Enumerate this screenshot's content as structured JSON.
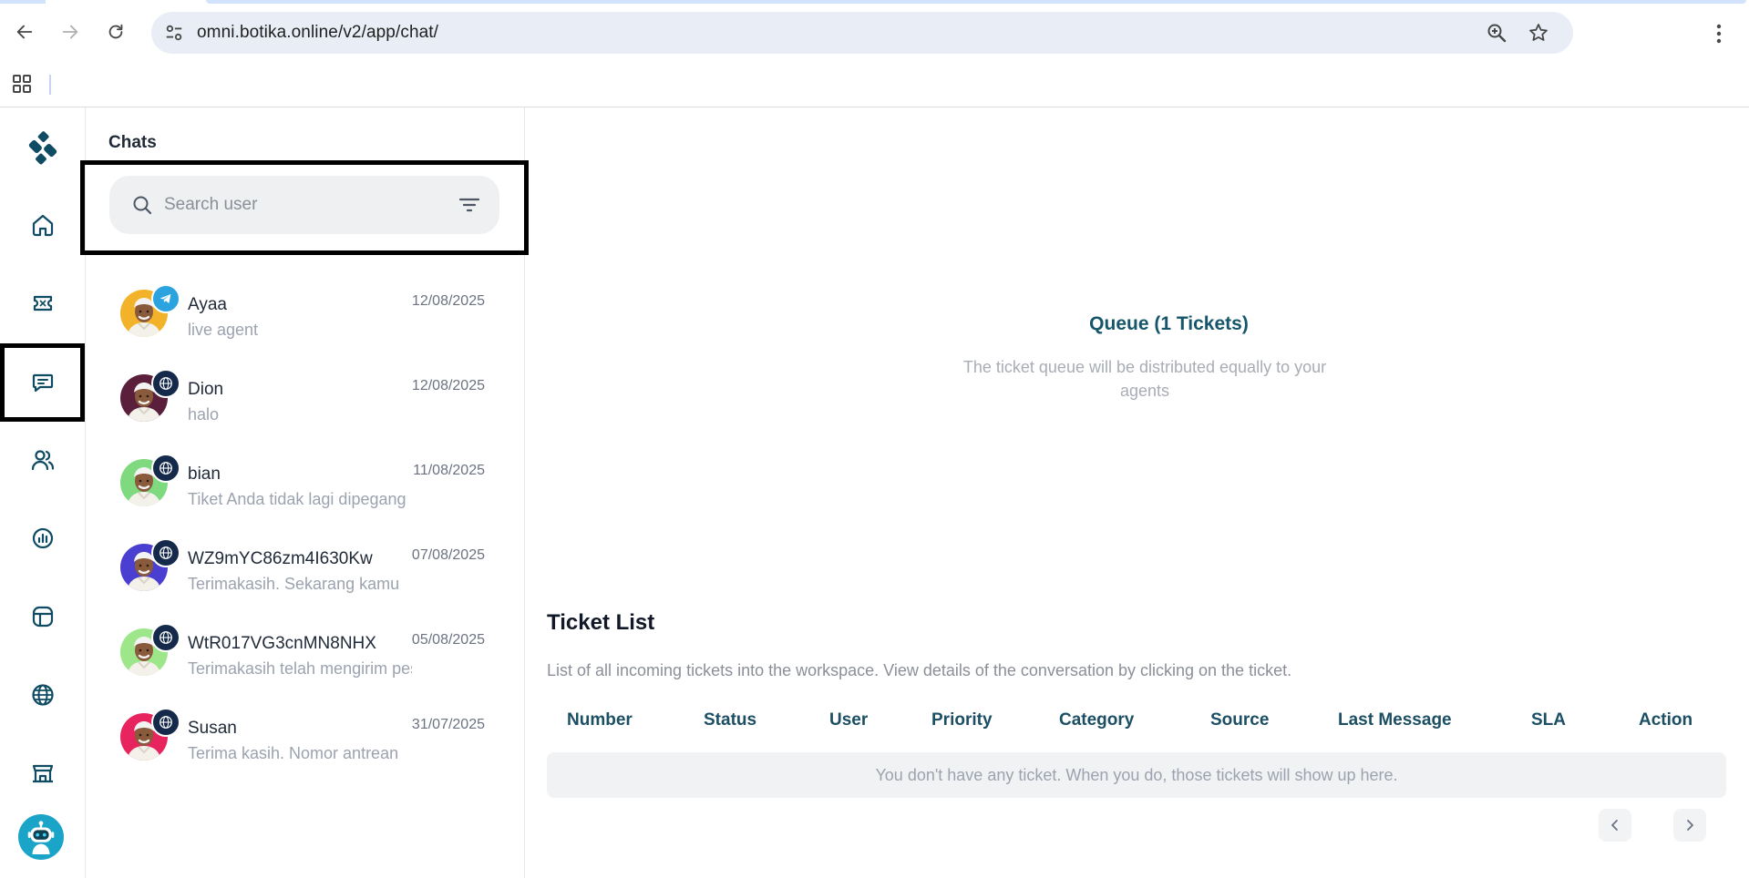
{
  "browser": {
    "url": "omni.botika.online/v2/app/chat/"
  },
  "colors": {
    "brand": "#0f4c63",
    "accent": "#16566a",
    "telegram": "#2aa3df",
    "web_badge": "#15294a"
  },
  "rail": {
    "items": [
      {
        "icon": "logo-icon"
      },
      {
        "icon": "home-icon"
      },
      {
        "icon": "ticket-icon"
      },
      {
        "icon": "chat-icon"
      },
      {
        "icon": "users-icon"
      },
      {
        "icon": "analytics-icon"
      },
      {
        "icon": "layout-icon"
      },
      {
        "icon": "globe-icon"
      },
      {
        "icon": "store-icon"
      },
      {
        "icon": "bot-avatar-icon"
      }
    ]
  },
  "chats": {
    "title": "Chats",
    "search_placeholder": "Search user",
    "items": [
      {
        "name": "Ayaa",
        "date": "12/08/2025",
        "message": "live agent",
        "channel": "telegram",
        "avatar_bg": "#f2b32a"
      },
      {
        "name": "Dion",
        "date": "12/08/2025",
        "message": "halo",
        "channel": "web",
        "avatar_bg": "#5a1f3a"
      },
      {
        "name": "bian",
        "date": "11/08/2025",
        "message": "Tiket Anda tidak lagi dipegang",
        "channel": "web",
        "avatar_bg": "#7ed97f"
      },
      {
        "name": "WZ9mYC86zm4I630Kw",
        "date": "07/08/2025",
        "message": "Terimakasih. Sekarang kamu",
        "channel": "web",
        "avatar_bg": "#4a3fd0"
      },
      {
        "name": "WtR017VG3cnMN8NHX",
        "date": "05/08/2025",
        "message": "Terimakasih telah mengirim pesan",
        "channel": "web",
        "avatar_bg": "#9ee68a"
      },
      {
        "name": "Susan",
        "date": "31/07/2025",
        "message": "Terima kasih. Nomor antrean",
        "channel": "web",
        "avatar_bg": "#e8245f"
      }
    ]
  },
  "queue": {
    "title": "Queue (1 Tickets)",
    "subtitle": "The ticket queue will be distributed equally to your agents"
  },
  "ticket_list": {
    "title": "Ticket List",
    "subtitle": "List of all incoming tickets into the workspace. View details of the conversation by clicking on the ticket.",
    "columns": [
      "Number",
      "Status",
      "User",
      "Priority",
      "Category",
      "Source",
      "Last Message",
      "SLA",
      "Action"
    ],
    "empty_text": "You don't have any ticket. When you do, those tickets will show up here."
  }
}
